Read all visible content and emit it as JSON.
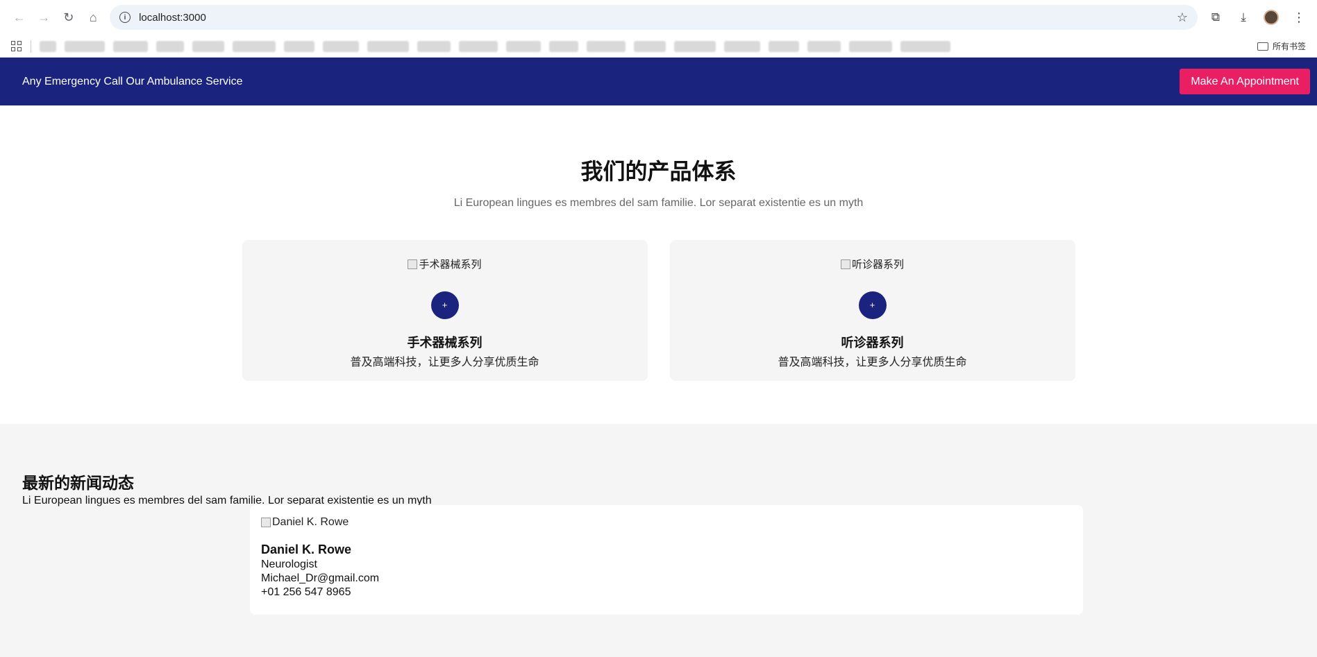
{
  "browser": {
    "url": "localhost:3000",
    "bookmarks_folder_label": "所有书签"
  },
  "topbar": {
    "text": "Any Emergency Call Our Ambulance Service",
    "button_label": "Make An Appointment"
  },
  "products": {
    "title": "我们的产品体系",
    "subtitle": "Li European lingues es membres del sam familie. Lor separat existentie es un myth",
    "cards": [
      {
        "image_alt": "手术器械系列",
        "plus": "+",
        "title": "手术器械系列",
        "desc": "普及高端科技，让更多人分享优质生命"
      },
      {
        "image_alt": "听诊器系列",
        "plus": "+",
        "title": "听诊器系列",
        "desc": "普及高端科技，让更多人分享优质生命"
      }
    ]
  },
  "news": {
    "title": "最新的新闻动态",
    "subtitle": "Li European lingues es membres del sam familie. Lor separat existentie es un myth",
    "card": {
      "image_alt": "Daniel K. Rowe",
      "name": "Daniel K. Rowe",
      "role": "Neurologist",
      "email": "Michael_Dr@gmail.com",
      "phone": "+01 256 547 8965"
    }
  },
  "colors": {
    "primary": "#1a237e",
    "accent": "#e91e63",
    "section_bg": "#f5f5f5"
  }
}
